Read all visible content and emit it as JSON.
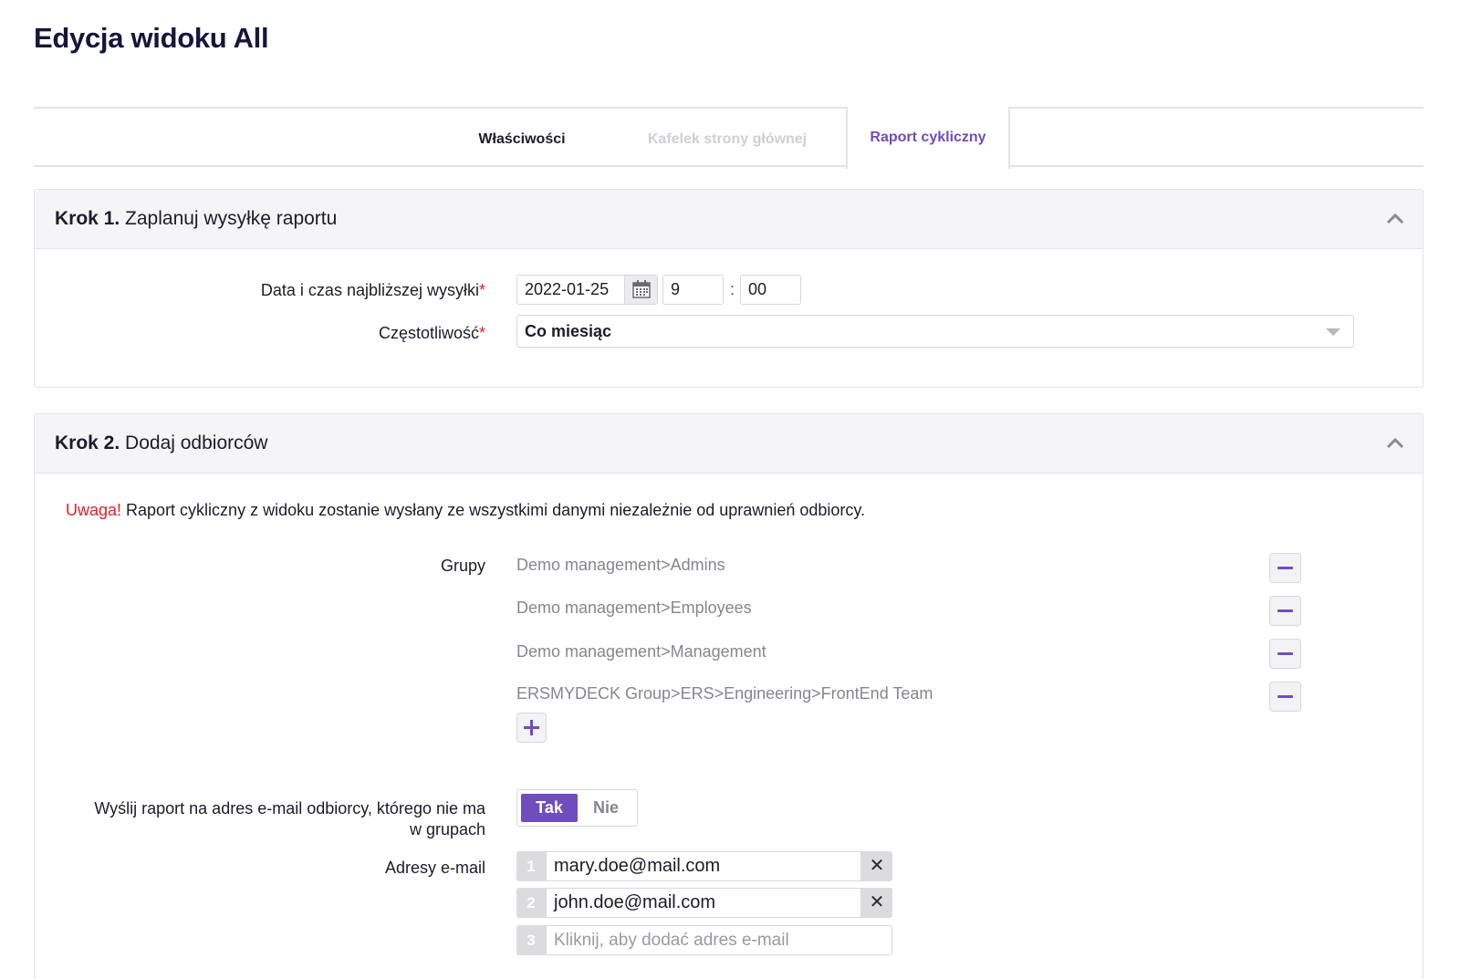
{
  "page": {
    "title": "Edycja widoku All"
  },
  "tabs": [
    {
      "label": "Właściwości",
      "state": "normal"
    },
    {
      "label": "Kafelek strony głównej",
      "state": "disabled"
    },
    {
      "label": "Raport cykliczny",
      "state": "active"
    }
  ],
  "step1": {
    "step": "Krok 1.",
    "title": "Zaplanuj wysyłkę raportu",
    "date_label": "Data i czas najbliższej wysyłki",
    "date_value": "2022-01-25",
    "hour_value": "9",
    "time_sep": ":",
    "minute_value": "00",
    "frequency_label": "Częstotliwość",
    "frequency_value": "Co miesiąc",
    "required_mark": "*"
  },
  "step2": {
    "step": "Krok 2.",
    "title": "Dodaj odbiorców",
    "warning_prefix": "Uwaga!",
    "warning_text": " Raport cykliczny z widoku zostanie wysłany ze wszystkimi danymi niezależnie od uprawnień odbiorcy.",
    "groups_label": "Grupy",
    "groups": [
      "Demo management>Admins",
      "Demo management>Employees",
      "Demo management>Management",
      "ERSMYDECK Group>ERS>Engineering>FrontEnd Team"
    ],
    "send_outside_label_1": "Wyślij raport na adres e-mail odbiorcy, którego nie ma",
    "send_outside_label_2": "w grupach",
    "toggle_yes": "Tak",
    "toggle_no": "Nie",
    "toggle_selected": "Tak",
    "emails_label": "Adresy e-mail",
    "emails": [
      {
        "num": "1",
        "value": "mary.doe@mail.com"
      },
      {
        "num": "2",
        "value": "john.doe@mail.com"
      }
    ],
    "new_email_num": "3",
    "new_email_placeholder": "Kliknij, aby dodać adres e-mail"
  },
  "colors": {
    "accent": "#6f4dbf",
    "required": "#e0202a",
    "muted": "#86868c"
  }
}
